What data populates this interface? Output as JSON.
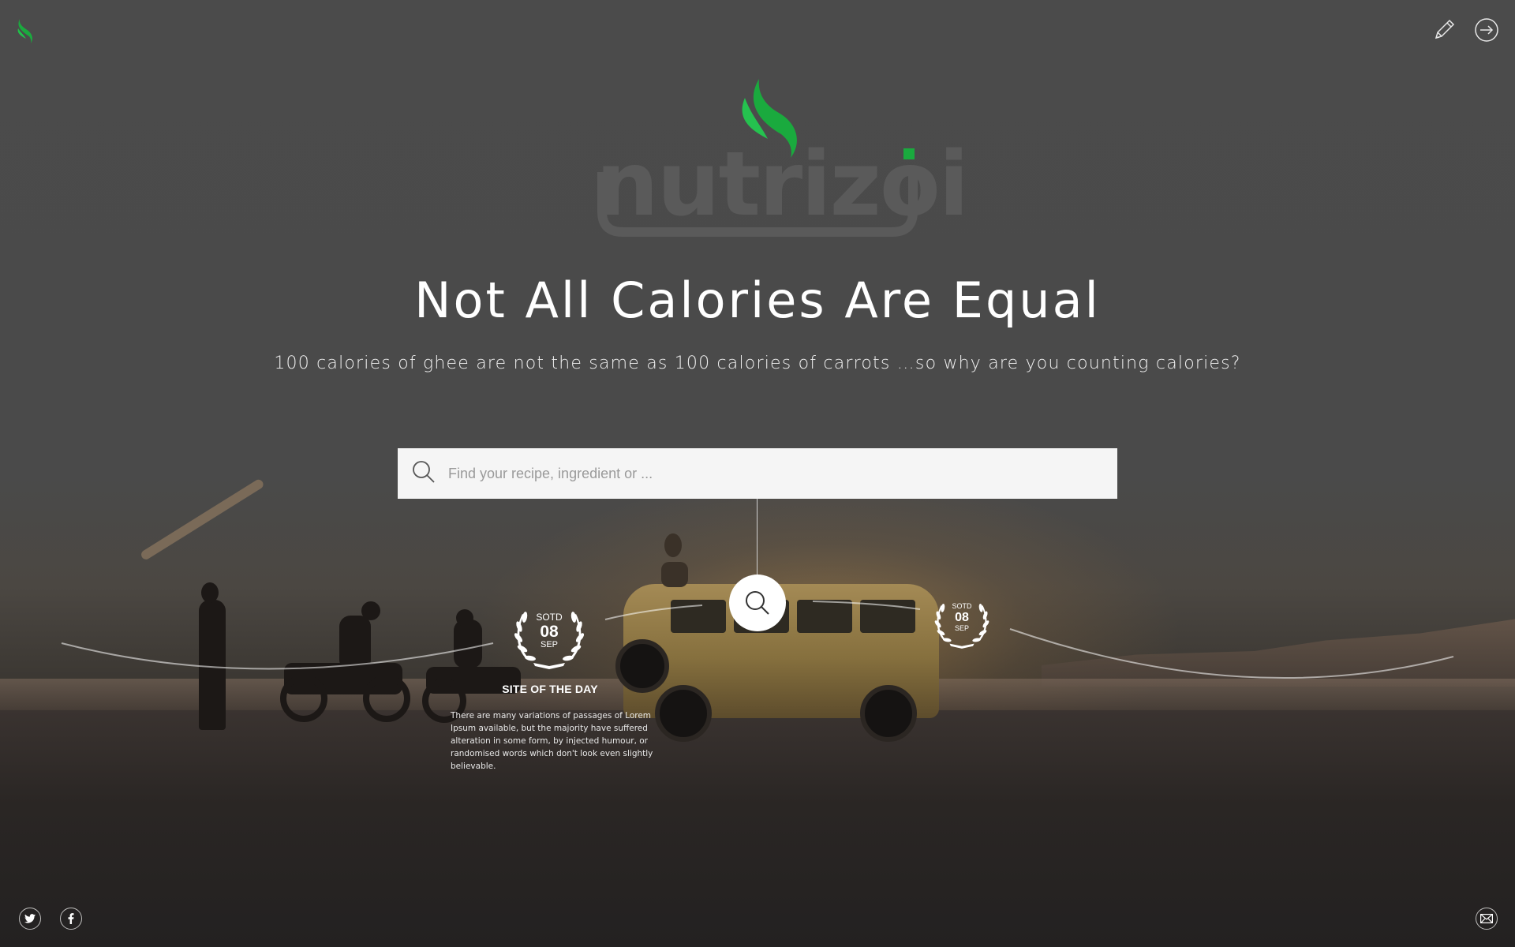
{
  "hero": {
    "logo_text": "nutrizoi",
    "title": "Not All Calories Are Equal",
    "subtitle": "100 calories of ghee are not the same as 100 calories of carrots …so why are you counting calories?"
  },
  "search": {
    "placeholder": "Find your recipe, ingredient or ..."
  },
  "awards": [
    {
      "label": "SOTD",
      "day": "08",
      "month": "SEP"
    },
    {
      "label": "SOTD",
      "day": "08",
      "month": "SEP"
    }
  ],
  "site_of_the_day": {
    "title": "SITE OF THE DAY",
    "description": "There are many variations of passages of Lorem Ipsum available, but the majority have suffered alteration in some form, by injected humour, or randomised words which don't look even slightly believable."
  },
  "icons": {
    "top_left": "leaf-logo-icon",
    "top_right": [
      "pencil-icon",
      "sign-in-icon"
    ],
    "search": "search-icon",
    "social": [
      "twitter-icon",
      "facebook-icon"
    ],
    "contact": "mail-icon"
  },
  "colors": {
    "brand_green": "#1aaa3e",
    "overlay": "#4a4a4a",
    "search_bg": "#f5f5f5"
  }
}
